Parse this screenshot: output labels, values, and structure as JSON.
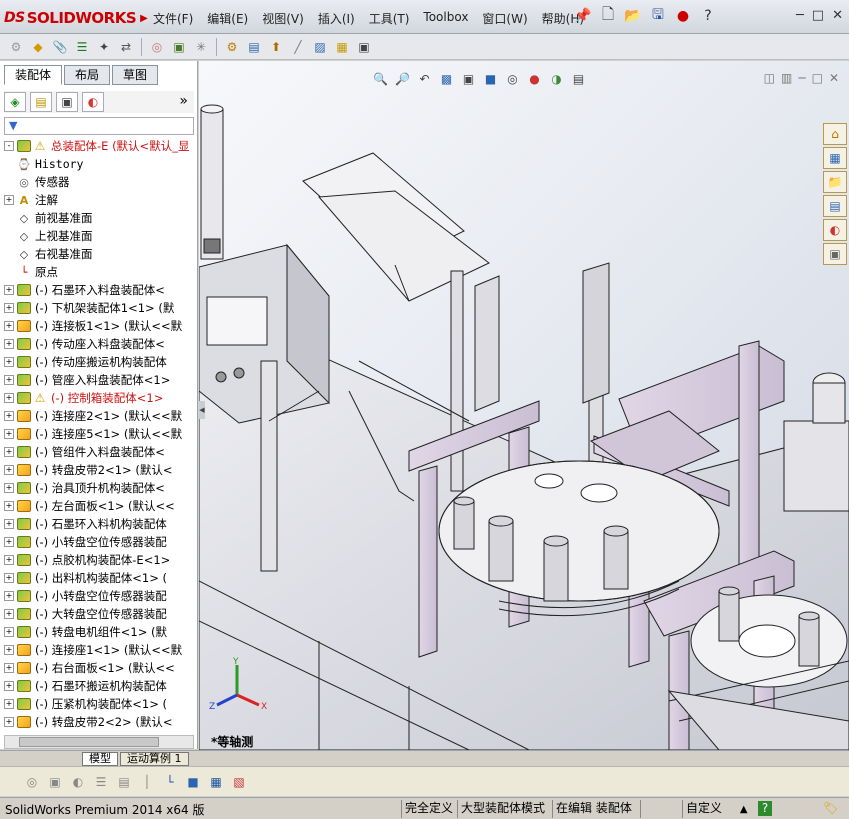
{
  "app": {
    "brand": "SOLIDWORKS",
    "brand_prefix": "DS"
  },
  "menu": [
    "文件(F)",
    "编辑(E)",
    "视图(V)",
    "插入(I)",
    "工具(T)",
    "Toolbox",
    "窗口(W)",
    "帮助(H)"
  ],
  "feature_manager": {
    "tabs": [
      "装配体",
      "布局",
      "草图"
    ],
    "active_tab": "装配体",
    "filter_label": "▼",
    "tree": [
      {
        "label": "总装配体-E  (默认<默认_显",
        "icon": "assembly-icon",
        "expand": "-",
        "style": "red",
        "warn": true
      },
      {
        "label": "History",
        "icon": "history-icon",
        "expand": "",
        "style": "mono"
      },
      {
        "label": "传感器",
        "icon": "sensor-icon",
        "expand": ""
      },
      {
        "label": "注解",
        "icon": "annotation-icon",
        "expand": "+"
      },
      {
        "label": "前视基准面",
        "icon": "plane-icon",
        "expand": ""
      },
      {
        "label": "上视基准面",
        "icon": "plane-icon",
        "expand": ""
      },
      {
        "label": "右视基准面",
        "icon": "plane-icon",
        "expand": ""
      },
      {
        "label": "原点",
        "icon": "origin-icon",
        "expand": ""
      },
      {
        "label": "(-) 石墨环入料盘装配体<",
        "icon": "assembly-icon",
        "expand": "+"
      },
      {
        "label": "(-) 下机架装配体1<1> (默",
        "icon": "assembly-icon",
        "expand": "+"
      },
      {
        "label": "(-) 连接板1<1> (默认<<默",
        "icon": "part-icon",
        "expand": "+"
      },
      {
        "label": "(-) 传动座入料盘装配体<",
        "icon": "assembly-icon",
        "expand": "+"
      },
      {
        "label": "(-) 传动座搬运机构装配体",
        "icon": "assembly-icon",
        "expand": "+"
      },
      {
        "label": "(-) 管座入料盘装配体<1>",
        "icon": "assembly-icon",
        "expand": "+"
      },
      {
        "label": "(-) 控制箱装配体<1>",
        "icon": "assembly-icon",
        "expand": "+",
        "style": "red",
        "warn": true
      },
      {
        "label": "(-) 连接座2<1> (默认<<默",
        "icon": "part-icon",
        "expand": "+"
      },
      {
        "label": "(-) 连接座5<1> (默认<<默",
        "icon": "part-icon",
        "expand": "+"
      },
      {
        "label": "(-) 管组件入料盘装配体<",
        "icon": "assembly-icon",
        "expand": "+"
      },
      {
        "label": "(-) 转盘皮带2<1> (默认<",
        "icon": "part-icon",
        "expand": "+"
      },
      {
        "label": "(-) 治具顶升机构装配体<",
        "icon": "assembly-icon",
        "expand": "+"
      },
      {
        "label": "(-) 左台面板<1> (默认<<",
        "icon": "part-icon",
        "expand": "+"
      },
      {
        "label": "(-) 石墨环入料机构装配体",
        "icon": "assembly-icon",
        "expand": "+"
      },
      {
        "label": "(-) 小转盘空位传感器装配",
        "icon": "assembly-icon",
        "expand": "+"
      },
      {
        "label": "(-) 点胶机构装配体-E<1>",
        "icon": "assembly-icon",
        "expand": "+"
      },
      {
        "label": "(-) 出料机构装配体<1> (",
        "icon": "assembly-icon",
        "expand": "+"
      },
      {
        "label": "(-) 小转盘空位传感器装配",
        "icon": "assembly-icon",
        "expand": "+"
      },
      {
        "label": "(-) 大转盘空位传感器装配",
        "icon": "assembly-icon",
        "expand": "+"
      },
      {
        "label": "(-) 转盘电机组件<1> (默",
        "icon": "assembly-icon",
        "expand": "+"
      },
      {
        "label": "(-) 连接座1<1> (默认<<默",
        "icon": "part-icon",
        "expand": "+"
      },
      {
        "label": "(-) 右台面板<1> (默认<<",
        "icon": "part-icon",
        "expand": "+"
      },
      {
        "label": "(-) 石墨环搬运机构装配体",
        "icon": "assembly-icon",
        "expand": "+"
      },
      {
        "label": "(-) 压紧机构装配体<1> (",
        "icon": "assembly-icon",
        "expand": "+"
      },
      {
        "label": "(-) 转盘皮带2<2> (默认<",
        "icon": "part-icon",
        "expand": "+"
      }
    ]
  },
  "bottom_tabs": [
    "模型",
    "运动算例 1"
  ],
  "active_bottom_tab": "模型",
  "viewport": {
    "view_name": "*等轴测",
    "triad": {
      "x": "X",
      "y": "Y",
      "z": "Z"
    }
  },
  "status": {
    "version": "SolidWorks Premium 2014 x64 版",
    "cells": [
      "完全定义",
      "大型装配体模式",
      "在编辑 装配体",
      "自定义"
    ],
    "help_icon": "?"
  },
  "colors": {
    "accent": "#cc1111",
    "panel": "#d4d0c8",
    "viewport_bg": "#e9ecf2",
    "machine_fill": "#d9cfe0",
    "machine_edge": "#222222"
  }
}
